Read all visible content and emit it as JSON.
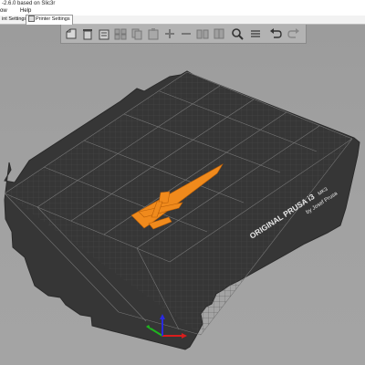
{
  "window": {
    "title": "-2.6.0 based on Slic3r"
  },
  "menu": {
    "items": [
      "ow",
      "Help"
    ]
  },
  "tabs": [
    {
      "label": "int Settings"
    },
    {
      "label": "Printer Settings"
    }
  ],
  "toolbar": {
    "tools": [
      {
        "icon": "add-icon"
      },
      {
        "icon": "delete-icon"
      },
      {
        "icon": "delete-all-icon"
      },
      {
        "icon": "arrange-icon"
      },
      {
        "icon": "copy-icon"
      },
      {
        "icon": "paste-icon"
      },
      {
        "icon": "add-instance-icon"
      },
      {
        "icon": "remove-instance-icon"
      },
      {
        "icon": "split-objects-icon"
      },
      {
        "icon": "split-parts-icon"
      },
      {
        "icon": "search-icon"
      },
      {
        "icon": "layers-icon"
      },
      {
        "icon": "undo-icon"
      },
      {
        "icon": "redo-icon"
      }
    ]
  },
  "bed": {
    "brand_text": "ORIGINAL PRUSA i3",
    "model_text": "MK3",
    "byline_text": "by Josef Prusa"
  },
  "colors": {
    "background": "#a0a0a0",
    "bed": "#3a3a3a",
    "model": "#f08a1c",
    "axis_x": "#d81d1d",
    "axis_y": "#1fb51f",
    "axis_z": "#2a2ae0"
  }
}
